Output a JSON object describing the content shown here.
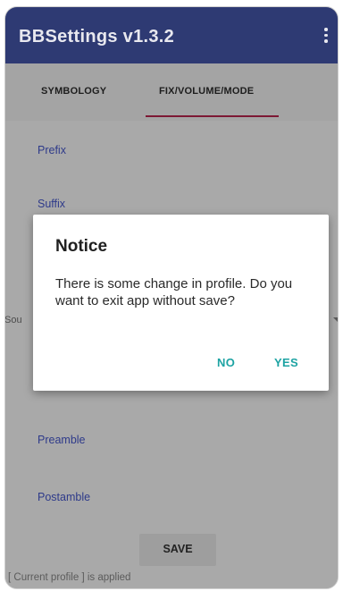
{
  "app": {
    "title": "BBSettings v1.3.2",
    "menu_icon": "more-vertical-icon"
  },
  "tabs": [
    {
      "label": "SYMBOLOGY",
      "active": false
    },
    {
      "label": "FIX/VOLUME/MODE",
      "active": true
    }
  ],
  "fields": {
    "prefix": "Prefix",
    "suffix": "Suffix",
    "partial_label": "Sou",
    "preamble": "Preamble",
    "postamble": "Postamble"
  },
  "save_label": "SAVE",
  "status_text": "[ Current profile ] is applied",
  "dialog": {
    "title": "Notice",
    "message": "There is some change in profile. Do you want to exit app without save?",
    "no_label": "NO",
    "yes_label": "YES"
  },
  "colors": {
    "appbar": "#2e3a73",
    "tab_indicator": "#7d1834",
    "field_text": "#2e3a8a",
    "dialog_button": "#1da3a3"
  }
}
